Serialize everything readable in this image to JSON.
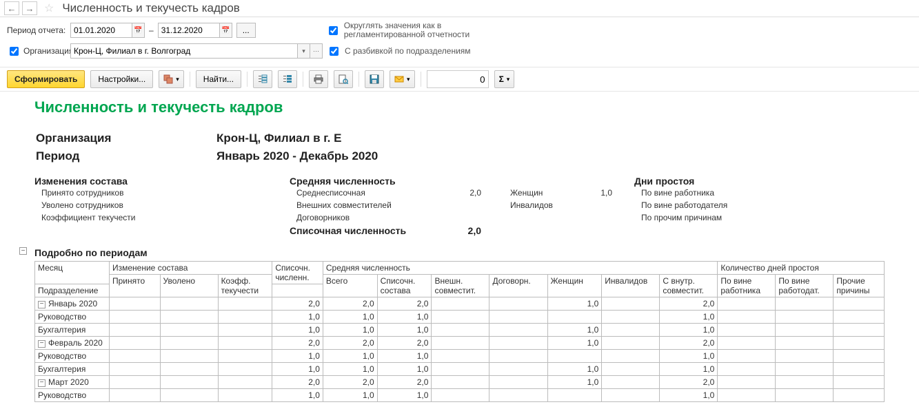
{
  "title": "Численность и текучесть кадров",
  "filters": {
    "period_label": "Период отчета:",
    "date_from": "01.01.2020",
    "date_sep": "–",
    "date_to": "31.12.2020",
    "more_btn": "...",
    "round_label": "Округлять значения как в регламентированной отчетности",
    "org_check_label": "Организация:",
    "org_value": "Крон-Ц, Филиал в г. Волгоград",
    "by_dept_label": "С разбивкой по подразделениям"
  },
  "toolbar": {
    "format": "Сформировать",
    "settings": "Настройки...",
    "find": "Найти...",
    "value_input": "0"
  },
  "report": {
    "title": "Численность и текучесть кадров",
    "meta": {
      "org_label": "Организация",
      "org_value": "Крон-Ц, Филиал в г. Е",
      "period_label": "Период",
      "period_value": "Январь 2020 - Декабрь 2020"
    },
    "summary": {
      "col1_h": "Изменения состава",
      "col1_r1": "Принято сотрудников",
      "col1_r2": "Уволено сотрудников",
      "col1_r3": "Коэффициент текучести",
      "col2_h": "Средняя численность",
      "col2_r1": "Среднесписочная",
      "col2_r1_v": "2,0",
      "col2_r2": "Внешних совместителей",
      "col2_r3": "Договорников",
      "col2_r4": "Списочная численность",
      "col2_r4_v": "2,0",
      "col3_r1": "Женщин",
      "col3_r1_v": "1,0",
      "col3_r2": "Инвалидов",
      "col4_h": "Дни простоя",
      "col4_r1": "По вине работника",
      "col4_r2": "По вине работодателя",
      "col4_r3": "По прочим причинам"
    },
    "detail_heading": "Подробно по периодам",
    "headers": {
      "month": "Месяц",
      "dept": "Подразделение",
      "change": "Изменение состава",
      "hired": "Принято",
      "fired": "Уволено",
      "coef": "Коэфф. текучести",
      "list_count": "Списочн. численн.",
      "avg_count": "Средняя численность",
      "total": "Всего",
      "list_comp": "Списочн. состава",
      "ext": "Внешн. совместит.",
      "contract": "Договорн.",
      "women": "Женщин",
      "disabled": "Инвалидов",
      "internal": "С внутр. совместит.",
      "idle": "Количество дней простоя",
      "idle_emp": "По вине работника",
      "idle_org": "По вине работодат.",
      "idle_other": "Прочие причины"
    },
    "rows": [
      {
        "label": "Январь 2020",
        "level": 0,
        "expand": "-",
        "vals": [
          "",
          "",
          "",
          "2,0",
          "2,0",
          "2,0",
          "",
          "",
          "1,0",
          "",
          "2,0",
          "",
          "",
          ""
        ]
      },
      {
        "label": "Руководство",
        "level": 1,
        "vals": [
          "",
          "",
          "",
          "1,0",
          "1,0",
          "1,0",
          "",
          "",
          "",
          "",
          "1,0",
          "",
          "",
          ""
        ]
      },
      {
        "label": "Бухгалтерия",
        "level": 1,
        "vals": [
          "",
          "",
          "",
          "1,0",
          "1,0",
          "1,0",
          "",
          "",
          "1,0",
          "",
          "1,0",
          "",
          "",
          ""
        ]
      },
      {
        "label": "Февраль 2020",
        "level": 0,
        "expand": "-",
        "vals": [
          "",
          "",
          "",
          "2,0",
          "2,0",
          "2,0",
          "",
          "",
          "1,0",
          "",
          "2,0",
          "",
          "",
          ""
        ]
      },
      {
        "label": "Руководство",
        "level": 1,
        "vals": [
          "",
          "",
          "",
          "1,0",
          "1,0",
          "1,0",
          "",
          "",
          "",
          "",
          "1,0",
          "",
          "",
          ""
        ]
      },
      {
        "label": "Бухгалтерия",
        "level": 1,
        "vals": [
          "",
          "",
          "",
          "1,0",
          "1,0",
          "1,0",
          "",
          "",
          "1,0",
          "",
          "1,0",
          "",
          "",
          ""
        ]
      },
      {
        "label": "Март 2020",
        "level": 0,
        "expand": "-",
        "vals": [
          "",
          "",
          "",
          "2,0",
          "2,0",
          "2,0",
          "",
          "",
          "1,0",
          "",
          "2,0",
          "",
          "",
          ""
        ]
      },
      {
        "label": "Руководство",
        "level": 1,
        "vals": [
          "",
          "",
          "",
          "1,0",
          "1,0",
          "1,0",
          "",
          "",
          "",
          "",
          "1,0",
          "",
          "",
          ""
        ]
      }
    ]
  }
}
